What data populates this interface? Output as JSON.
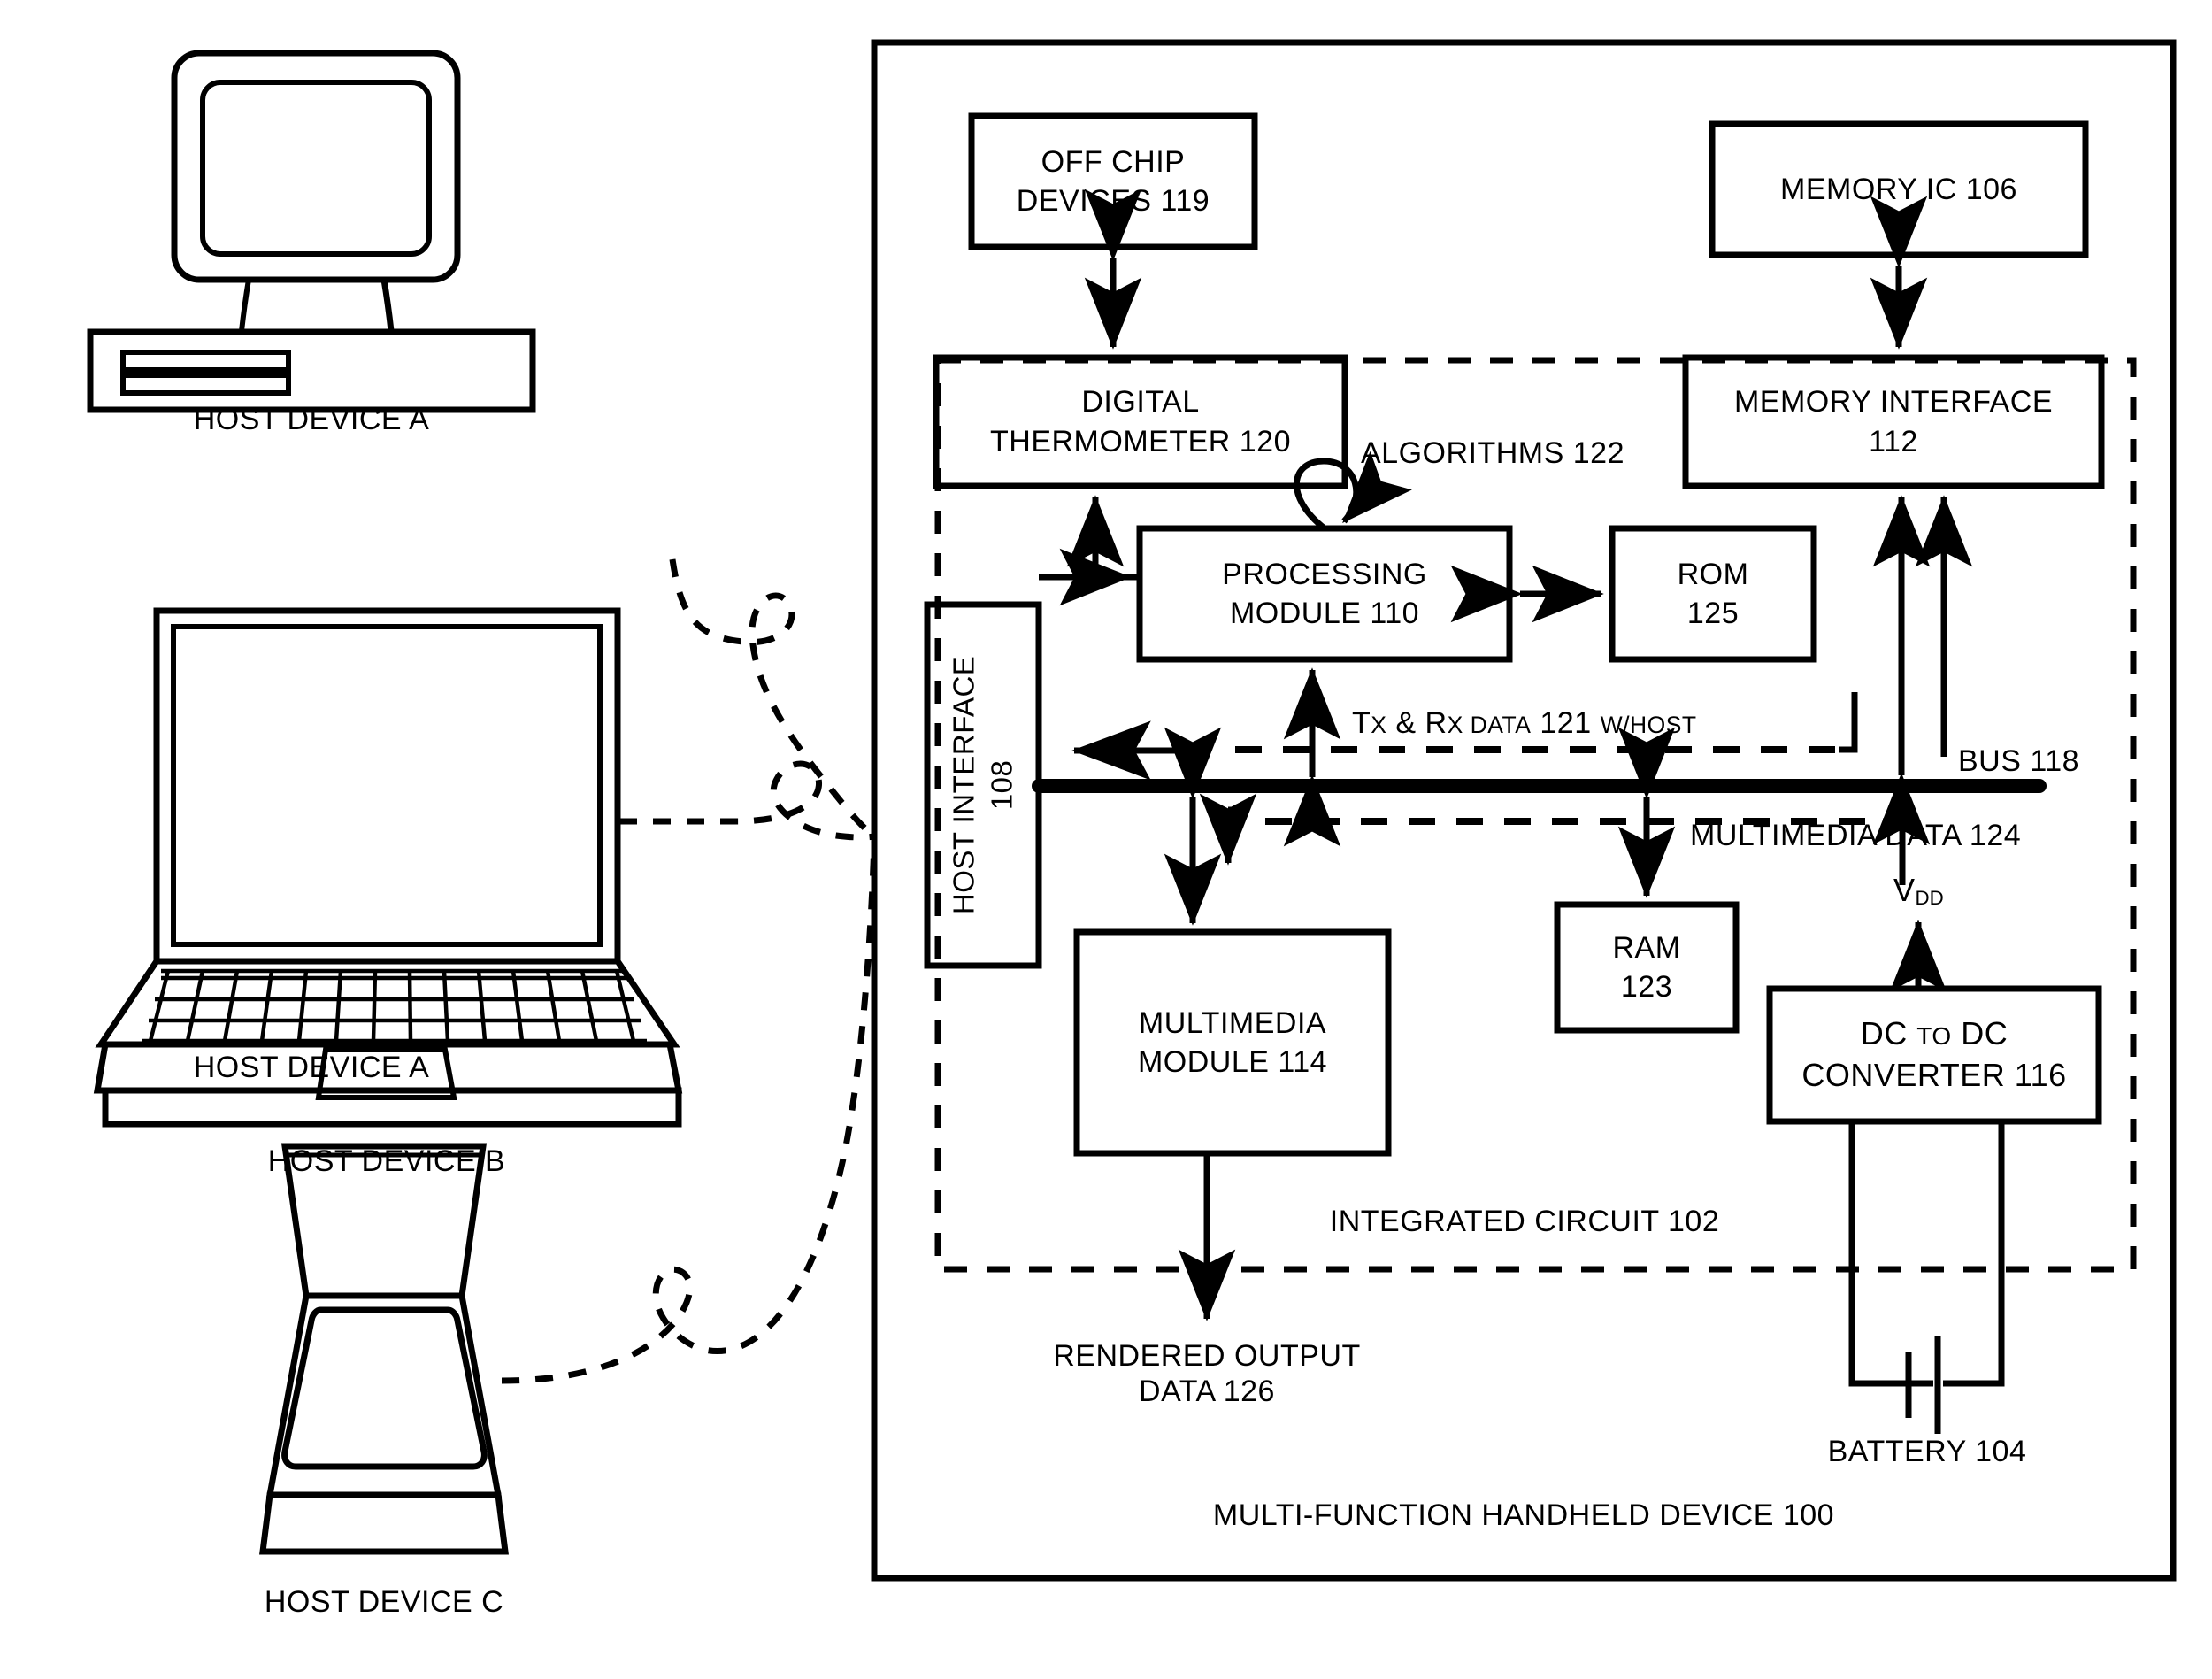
{
  "figure": {
    "outer_device_label": "MULTI-FUNCTION HANDHELD DEVICE 100",
    "integrated_circuit_label": "INTEGRATED CIRCUIT 102"
  },
  "hosts": [
    {
      "id": "a",
      "label": "HOST DEVICE A",
      "icon": "desktop-computer-icon"
    },
    {
      "id": "b",
      "label": "HOST DEVICE B",
      "icon": "laptop-computer-icon"
    },
    {
      "id": "c",
      "label": "HOST DEVICE C",
      "icon": "flatbed-scanner-icon"
    }
  ],
  "blocks": {
    "off_chip_devices": {
      "line1": "OFF CHIP",
      "line2": "DEVICES 119"
    },
    "memory_ic": {
      "line1": "MEMORY IC 106"
    },
    "digital_thermometer": {
      "line1": "DIGITAL",
      "line2": "THERMOMETER 120"
    },
    "memory_interface": {
      "line1": "MEMORY INTERFACE",
      "line2": "112"
    },
    "processing_module": {
      "line1": "PROCESSING",
      "line2": "MODULE 110"
    },
    "rom": {
      "line1": "ROM",
      "line2": "125"
    },
    "host_interface": {
      "line1": "HOST INTERFACE",
      "line2": "108"
    },
    "multimedia_module": {
      "line1": "MULTIMEDIA",
      "line2": "MODULE 114"
    },
    "ram": {
      "line1": "RAM",
      "line2": "123"
    },
    "dc_to_dc_converter": {
      "line1": "DC TO DC",
      "line1_small": "TO",
      "line2": "CONVERTER 116"
    }
  },
  "annotations": {
    "algorithms": "ALGORITHMS 122",
    "tx_rx_data": {
      "prefix": "T",
      "x1": "x",
      "amp": " & R",
      "x2": "x",
      "mid": " DATA 121 ",
      "suffix": "w/HOST",
      "full": "Tx & Rx DATA 121 w/HOST"
    },
    "bus": "BUS 118",
    "multimedia_data": "MULTIMEDIA DATA 124",
    "vdd": {
      "base": "V",
      "sub": "DD"
    },
    "battery": "BATTERY 104",
    "rendered_output": {
      "line1": "RENDERED OUTPUT",
      "line2": "DATA 126"
    }
  },
  "colors": {
    "ink": "#000000",
    "paper": "#ffffff"
  }
}
